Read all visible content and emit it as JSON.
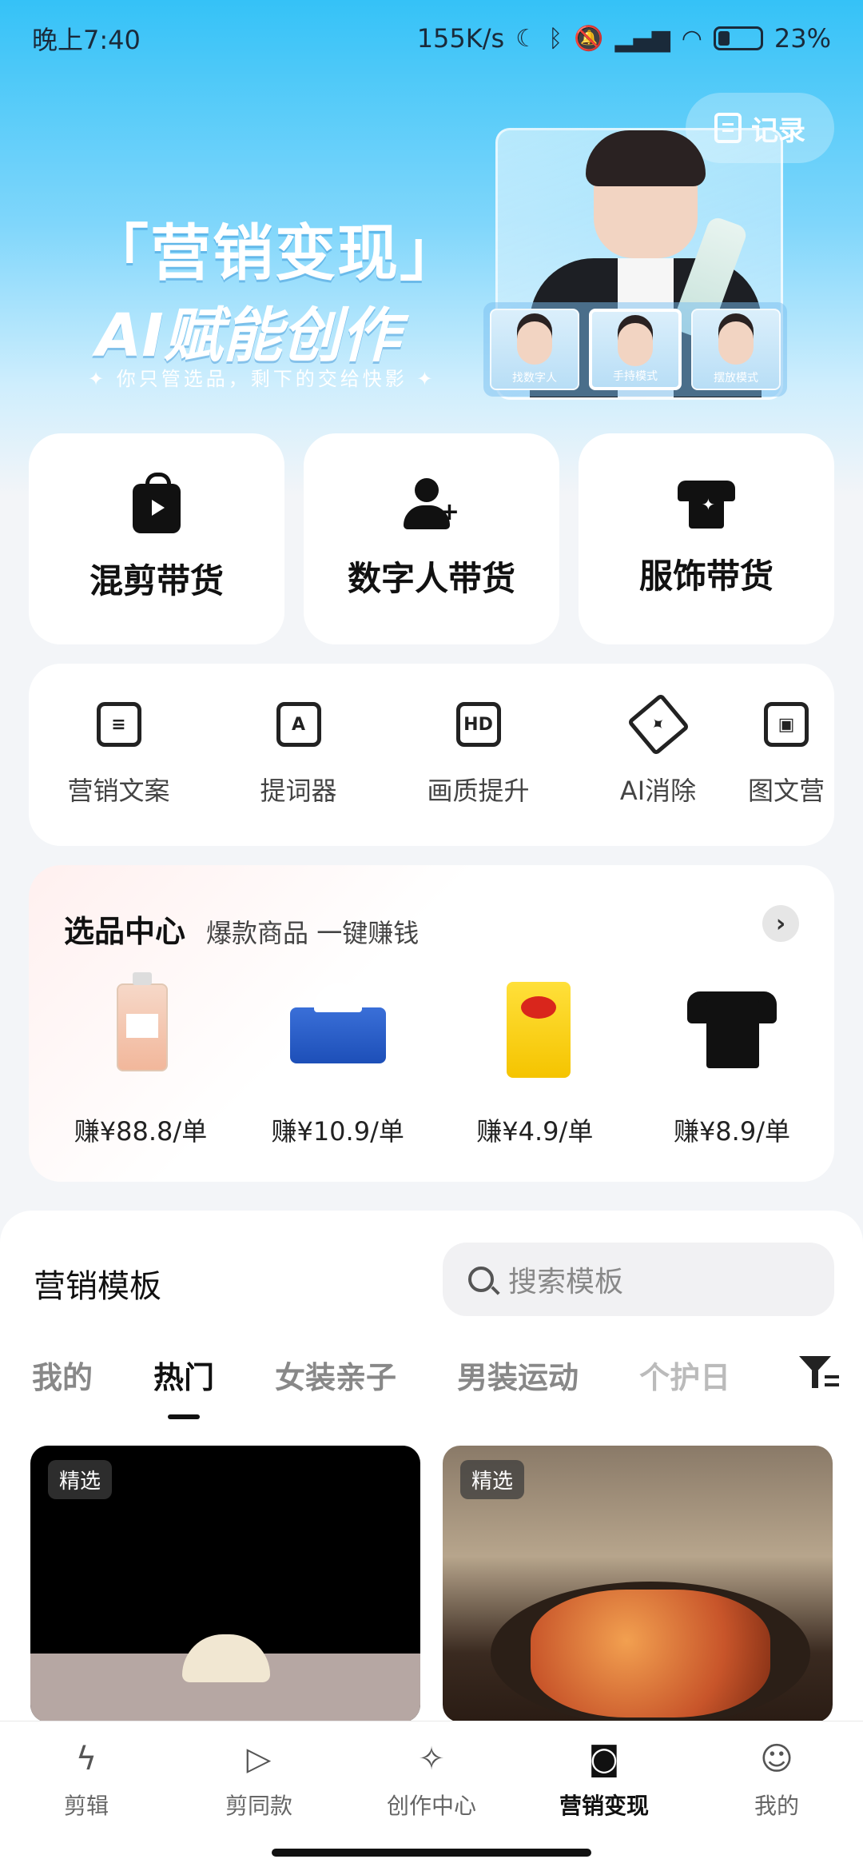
{
  "status_bar": {
    "time": "晚上7:40",
    "net_speed": "155K/s",
    "battery": "23%"
  },
  "hero": {
    "record_label": "记录",
    "title": "「营销变现」",
    "subtitle": "AI赋能创作",
    "note": "✦ 你只管选品，剩下的交给快影 ✦",
    "thumbs": [
      "找数字人",
      "手持模式",
      "摆放模式"
    ]
  },
  "big_cards": [
    {
      "label": "混剪带货",
      "icon": "shopping-bag-play-icon"
    },
    {
      "label": "数字人带货",
      "icon": "person-add-icon"
    },
    {
      "label": "服饰带货",
      "icon": "tshirt-icon"
    }
  ],
  "tools": [
    {
      "label": "营销文案",
      "icon": "copywriting-icon"
    },
    {
      "label": "提词器",
      "icon": "teleprompter-icon"
    },
    {
      "label": "画质提升",
      "icon": "hd-icon"
    },
    {
      "label": "AI消除",
      "icon": "eraser-icon"
    },
    {
      "label": "图文营",
      "icon": "image-text-icon"
    }
  ],
  "product_center": {
    "title": "选品中心",
    "subtitle": "爆款商品 一键赚钱",
    "products": [
      {
        "price": "赚¥88.8/单",
        "item": "perfume"
      },
      {
        "price": "赚¥10.9/单",
        "item": "tissue"
      },
      {
        "price": "赚¥4.9/单",
        "item": "chips"
      },
      {
        "price": "赚¥8.9/单",
        "item": "tshirt"
      }
    ]
  },
  "templates": {
    "title": "营销模板",
    "search_placeholder": "搜索模板",
    "tabs": [
      "我的",
      "热门",
      "女装亲子",
      "男装运动",
      "个护日"
    ],
    "active_tab": "热门",
    "cards": [
      {
        "badge": "精选"
      },
      {
        "badge": "精选"
      }
    ]
  },
  "bottom_nav": [
    {
      "label": "剪辑",
      "icon": "lightning-icon"
    },
    {
      "label": "剪同款",
      "icon": "video-template-icon"
    },
    {
      "label": "创作中心",
      "icon": "create-center-icon"
    },
    {
      "label": "营销变现",
      "icon": "shopping-bag-icon"
    },
    {
      "label": "我的",
      "icon": "smile-icon"
    }
  ],
  "active_nav": "营销变现"
}
